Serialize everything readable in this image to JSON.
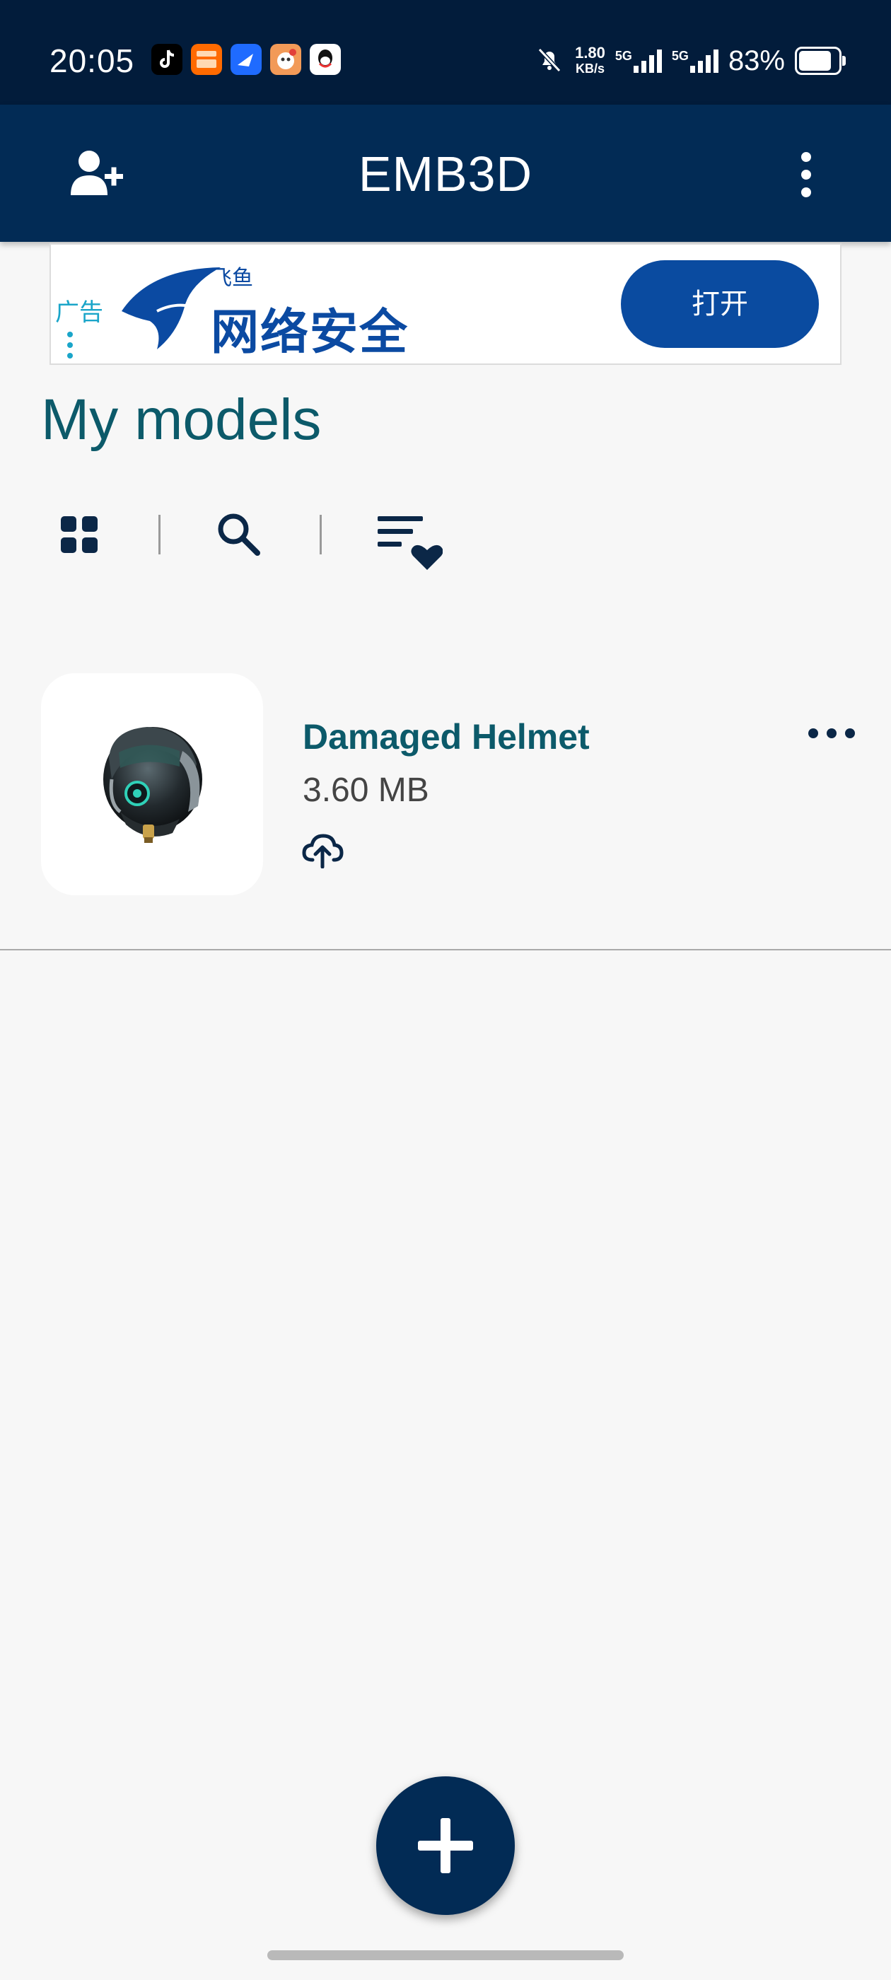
{
  "status_bar": {
    "time": "20:05",
    "net_speed_value": "1.80",
    "net_speed_unit": "KB/s",
    "sim1_label": "5G",
    "sim2_label": "5G",
    "battery_percent": "83%",
    "battery_level": 0.83,
    "notification_icons": [
      "tiktok-icon",
      "taobao-icon",
      "feishu-icon",
      "game-icon",
      "qq-icon"
    ],
    "silent_icon": "bell-off-icon"
  },
  "app_bar": {
    "title": "EMB3D",
    "left_icon": "add-user-icon",
    "right_icon": "more-vertical-icon"
  },
  "ad": {
    "label": "广告",
    "brand": "飞鱼",
    "headline": "网络安全",
    "button_label": "打开"
  },
  "main": {
    "title": "My models",
    "toolbar": [
      "grid-view-icon",
      "search-icon",
      "sort-favorites-icon"
    ]
  },
  "models": [
    {
      "name": "Damaged Helmet",
      "size": "3.60 MB",
      "cloud_icon": "cloud-upload-icon",
      "menu_icon": "more-horizontal-icon"
    }
  ],
  "colors": {
    "status_bar": "#021c3b",
    "app_bar": "#022b55",
    "accent_teal": "#0c5a6a",
    "ad_blue": "#0a4ba0",
    "background": "#f7f7f7"
  }
}
